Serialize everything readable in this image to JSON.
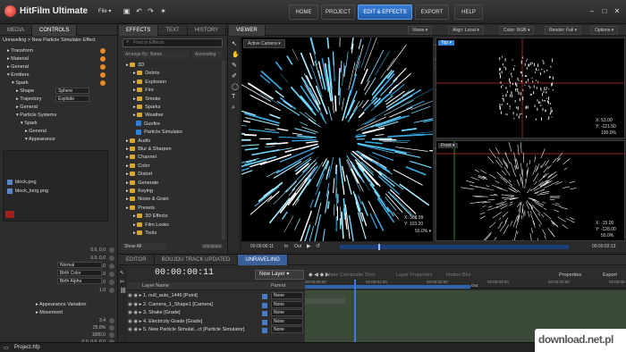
{
  "app": {
    "title": "HitFilm Ultimate",
    "file_menu": "File ▾"
  },
  "nav": {
    "home": "HOME",
    "project": "PROJECT",
    "edit_effects": "EDIT & EFFECTS",
    "export": "EXPORT",
    "help": "HELP"
  },
  "left": {
    "tabs": [
      "MEDIA",
      "CONTROLS"
    ],
    "breadcrumb": "Unraveling > New Particle Simulator Effect",
    "rows": [
      {
        "label": "Transform",
        "indent": 1
      },
      {
        "label": "Material",
        "indent": 1
      },
      {
        "label": "General",
        "indent": 1
      },
      {
        "label": "Emitters",
        "indent": 1,
        "open": true
      },
      {
        "label": "Spark",
        "indent": 2,
        "open": true
      },
      {
        "label": "Shape",
        "indent": 3,
        "value": "Sphere"
      },
      {
        "label": "Trajectory",
        "indent": 3,
        "value": "Explode"
      },
      {
        "label": "General",
        "indent": 3
      },
      {
        "label": "Particle Systems",
        "indent": 3,
        "open": true
      },
      {
        "label": "Spark",
        "indent": 4,
        "open": true
      },
      {
        "label": "General",
        "indent": 5
      },
      {
        "label": "Appearance",
        "indent": 5,
        "open": true
      }
    ],
    "files": [
      "block.png",
      "block_long.png"
    ],
    "values": [
      "0.0, 0.0",
      "0.0, 0.0",
      "0.0, 0.0",
      "1.0",
      "0.0",
      "1.0"
    ],
    "dropdowns": [
      "Normal",
      "Birth Color",
      "Birth Alpha"
    ],
    "lower": [
      {
        "label": "Appearance Variation"
      },
      {
        "label": "Movement"
      }
    ],
    "lower_values": [
      "3.4",
      "25.0%",
      "1000.0",
      "0.0, 0.0, 0.0",
      "0.0, 0.0, 0.0",
      "0.0, 0.0, 0.0",
      "1.0"
    ]
  },
  "effects": {
    "tabs": [
      "EFFECTS",
      "TEXT",
      "HISTORY"
    ],
    "search_placeholder": "Find in Effects",
    "arrange": "Arrange By: Name",
    "sort": "Ascending",
    "items": [
      {
        "label": "3D",
        "type": "folder",
        "indent": 0
      },
      {
        "label": "Debris",
        "type": "folder",
        "indent": 1
      },
      {
        "label": "Explosion",
        "type": "folder",
        "indent": 1
      },
      {
        "label": "Fire",
        "type": "folder",
        "indent": 1
      },
      {
        "label": "Smoke",
        "type": "folder",
        "indent": 1
      },
      {
        "label": "Sparks",
        "type": "folder",
        "indent": 1
      },
      {
        "label": "Weather",
        "type": "folder",
        "indent": 1
      },
      {
        "label": "Gunfire",
        "type": "fx",
        "indent": 1
      },
      {
        "label": "Particle Simulator",
        "type": "fx",
        "indent": 1
      },
      {
        "label": "Audio",
        "type": "folder",
        "indent": 0
      },
      {
        "label": "Blur & Sharpen",
        "type": "folder",
        "indent": 0
      },
      {
        "label": "Channel",
        "type": "folder",
        "indent": 0
      },
      {
        "label": "Color",
        "type": "folder",
        "indent": 0
      },
      {
        "label": "Distort",
        "type": "folder",
        "indent": 0
      },
      {
        "label": "Generate",
        "type": "folder",
        "indent": 0
      },
      {
        "label": "Keying",
        "type": "folder",
        "indent": 0
      },
      {
        "label": "Noise & Grain",
        "type": "folder",
        "indent": 0
      },
      {
        "label": "Presets",
        "type": "folder",
        "indent": 0
      },
      {
        "label": "3D Effects",
        "type": "folder",
        "indent": 1
      },
      {
        "label": "Film Looks",
        "type": "folder",
        "indent": 1
      },
      {
        "label": "Tools",
        "type": "folder",
        "indent": 1
      }
    ],
    "show": "Show All",
    "count": "176 Items"
  },
  "viewer": {
    "tab": "VIEWER",
    "views": "Views ▾",
    "align": "Align: Local ▾",
    "color": "Color: RGB ▾",
    "render": "Render: Full ▾",
    "options": "Options ▾",
    "camera": "Active Camera ▾",
    "top": "Top ▾",
    "front": "Front ▾",
    "top_coords": [
      "X: 53.00",
      "Y: -121.50"
    ],
    "top_zoom": "100.0%",
    "front_coords": [
      "X: -15.00",
      "Y: -128.00"
    ],
    "front_zoom": "50.0%",
    "main_coords": [
      "X: 368.99",
      "Y: 103.20"
    ],
    "main_zoom": "50.0% ▾",
    "time_left": "00:00:00:11",
    "in": "In",
    "out": "Out",
    "time_right": "00:00:02:13"
  },
  "timeline": {
    "tabs": [
      "EDITOR",
      "BOUJOU TRACK UPDATED",
      "UNRAVELING"
    ],
    "timecode": "00:00:00:11",
    "new_layer": "New Layer ▾",
    "make_composite": "Make Composite Shot",
    "layer_properties": "Layer Properties",
    "motion_blur": "Motion Blur",
    "properties": "Properties",
    "export": "Export",
    "layer_name": "Layer Name",
    "parent": "Parent",
    "layers": [
      "1. null_auto_1446 [Point]",
      "2. Camera_1_Shape1 [Camera]",
      "3. Shake [Grade]",
      "4. Electricity Grade [Grade]",
      "5. New Particle Simulat...ct [Particle Simulator]"
    ],
    "none": "None",
    "ruler": [
      "00:00:00:00",
      "00:00:01:00",
      "00:00:02:00",
      "00:00:03:00",
      "00:00:04:00",
      "00:00:05:00"
    ],
    "out": "Out"
  },
  "status": {
    "project": "Project.hfp"
  },
  "watermark": "download.net.pl",
  "colors": {
    "accent": "#2f7fd8",
    "orange": "#e88a2a"
  }
}
